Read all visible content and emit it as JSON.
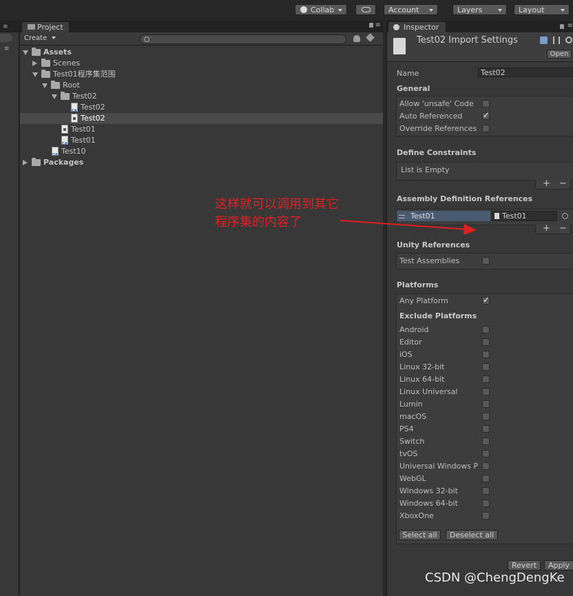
{
  "toolbar": {
    "collab": "Collab",
    "account": "Account",
    "layers": "Layers",
    "layout": "Layout"
  },
  "project": {
    "tab": "Project",
    "create": "Create",
    "tree": [
      {
        "label": "Assets",
        "depth": 0,
        "kind": "folder",
        "expand": "down",
        "bold": true
      },
      {
        "label": "Scenes",
        "depth": 1,
        "kind": "folder",
        "expand": "right"
      },
      {
        "label": "Test01程序集范围",
        "depth": 1,
        "kind": "folder",
        "expand": "down"
      },
      {
        "label": "Root",
        "depth": 2,
        "kind": "folder",
        "expand": "down"
      },
      {
        "label": "Test02",
        "depth": 3,
        "kind": "folder",
        "expand": "down"
      },
      {
        "label": "Test02",
        "depth": 4,
        "kind": "cs"
      },
      {
        "label": "Test02",
        "depth": 4,
        "kind": "asm",
        "selected": true
      },
      {
        "label": "Test01",
        "depth": 3,
        "kind": "asm"
      },
      {
        "label": "Test01",
        "depth": 3,
        "kind": "cs"
      },
      {
        "label": "Test10",
        "depth": 2,
        "kind": "cs"
      },
      {
        "label": "Packages",
        "depth": 0,
        "kind": "folder",
        "expand": "right",
        "bold": true
      }
    ]
  },
  "inspector": {
    "tab": "Inspector",
    "title": "Test02 Import Settings",
    "open": "Open",
    "name_label": "Name",
    "name_value": "Test02",
    "general": "General",
    "allow_unsafe": "Allow 'unsafe' Code",
    "auto_referenced": "Auto Referenced",
    "override_references": "Override References",
    "define_constraints": "Define Constraints",
    "list_empty": "List is Empty",
    "asm_def_refs": "Assembly Definition References",
    "ref_name": "Test01",
    "ref_object": "Test01",
    "unity_references": "Unity References",
    "test_assemblies": "Test Assemblies",
    "platforms": "Platforms",
    "any_platform": "Any Platform",
    "exclude_platforms": "Exclude Platforms",
    "platform_list": [
      "Android",
      "Editor",
      "iOS",
      "Linux 32-bit",
      "Linux 64-bit",
      "Linux Universal",
      "Lumin",
      "macOS",
      "PS4",
      "Switch",
      "tvOS",
      "Universal Windows P",
      "WebGL",
      "Windows 32-bit",
      "Windows 64-bit",
      "XboxOne"
    ],
    "select_all": "Select all",
    "deselect_all": "Deselect all",
    "revert": "Revert",
    "apply": "Apply"
  },
  "annotation": {
    "line1": "这样就可以调用到其它",
    "line2": "程序集的内容了"
  },
  "watermark": "CSDN @ChengDengKe",
  "colors": {
    "annotation": "#e02020",
    "panel": "#383838",
    "selection": "#4a4a4a"
  }
}
